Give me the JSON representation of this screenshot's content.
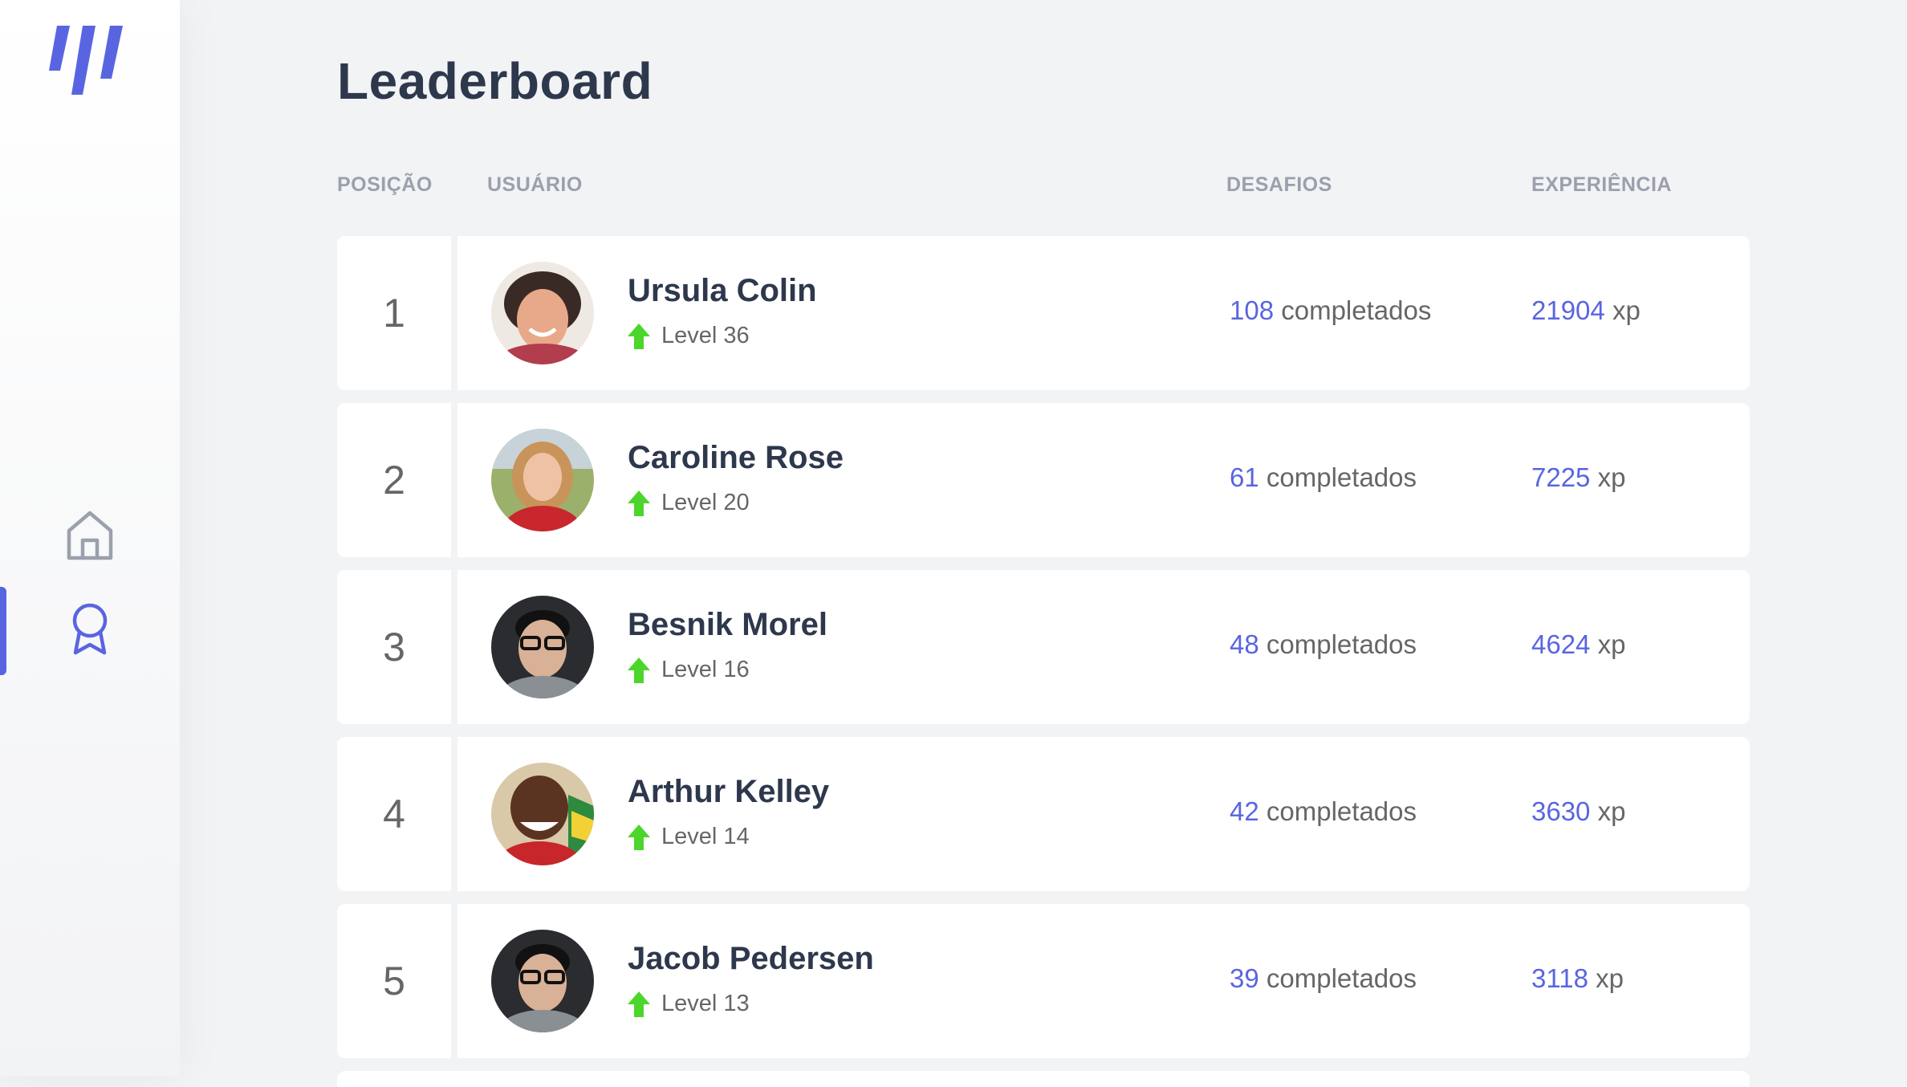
{
  "sidebar": {
    "logo_icon": "brand-slashes-logo",
    "nav": [
      {
        "icon": "home-icon",
        "active": false
      },
      {
        "icon": "award-icon",
        "active": true
      }
    ]
  },
  "page": {
    "title": "Leaderboard"
  },
  "columns": {
    "position": "POSIÇÃO",
    "user": "USUÁRIO",
    "challenges": "DESAFIOS",
    "experience": "EXPERIÊNCIA"
  },
  "labels": {
    "completed_suffix": "completados",
    "xp_suffix": "xp",
    "level_prefix": "Level"
  },
  "rows": [
    {
      "position": "1",
      "name": "Ursula Colin",
      "level": "Level 36",
      "challenges": "108",
      "challenges_suffix": "completados",
      "xp": "21904",
      "xp_suffix": "xp"
    },
    {
      "position": "2",
      "name": "Caroline Rose",
      "level": "Level 20",
      "challenges": "61",
      "challenges_suffix": "completados",
      "xp": "7225",
      "xp_suffix": "xp"
    },
    {
      "position": "3",
      "name": "Besnik Morel",
      "level": "Level 16",
      "challenges": "48",
      "challenges_suffix": "completados",
      "xp": "4624",
      "xp_suffix": "xp"
    },
    {
      "position": "4",
      "name": "Arthur Kelley",
      "level": "Level 14",
      "challenges": "42",
      "challenges_suffix": "completados",
      "xp": "3630",
      "xp_suffix": "xp"
    },
    {
      "position": "5",
      "name": "Jacob Pedersen",
      "level": "Level 13",
      "challenges": "39",
      "challenges_suffix": "completados",
      "xp": "3118",
      "xp_suffix": "xp"
    }
  ],
  "colors": {
    "accent": "#5965e0",
    "level_up": "#4cd62b",
    "background": "#f2f3f5",
    "title": "#2e384d",
    "muted": "#666666",
    "header": "#9aa0ac"
  }
}
